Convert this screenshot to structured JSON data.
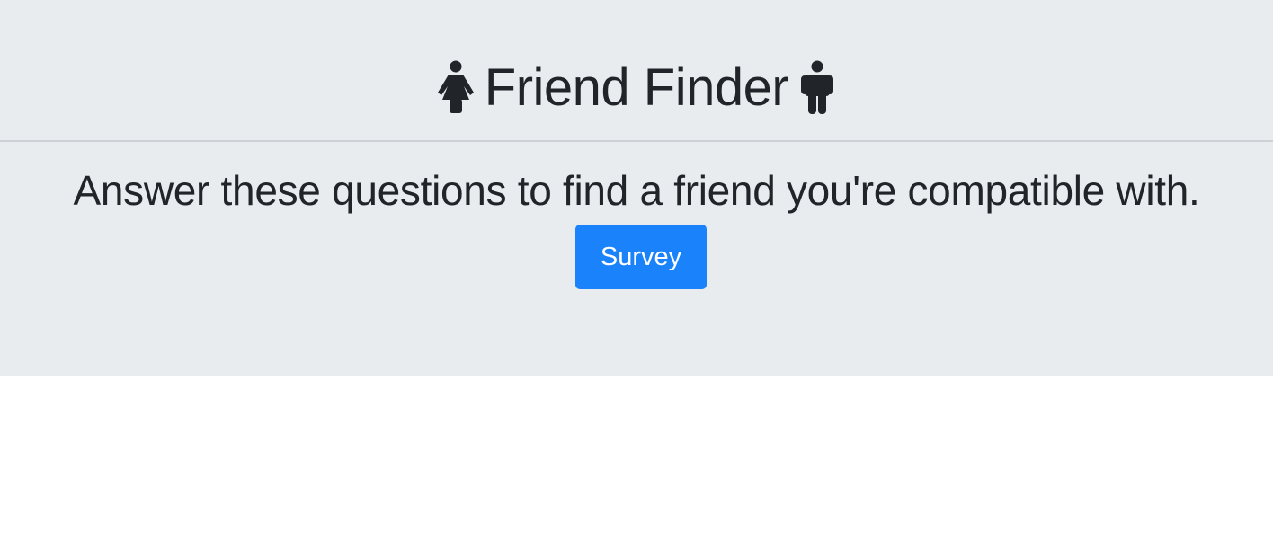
{
  "header": {
    "title": "Friend Finder",
    "left_icon": "female-person-icon",
    "right_icon": "male-person-icon"
  },
  "main": {
    "subtitle": "Answer these questions to find a friend you're compatible with.",
    "survey_button_label": "Survey"
  },
  "colors": {
    "jumbotron_background": "#e9ecef",
    "text": "#212529",
    "button_background": "#1a82fb",
    "button_text": "#ffffff"
  }
}
